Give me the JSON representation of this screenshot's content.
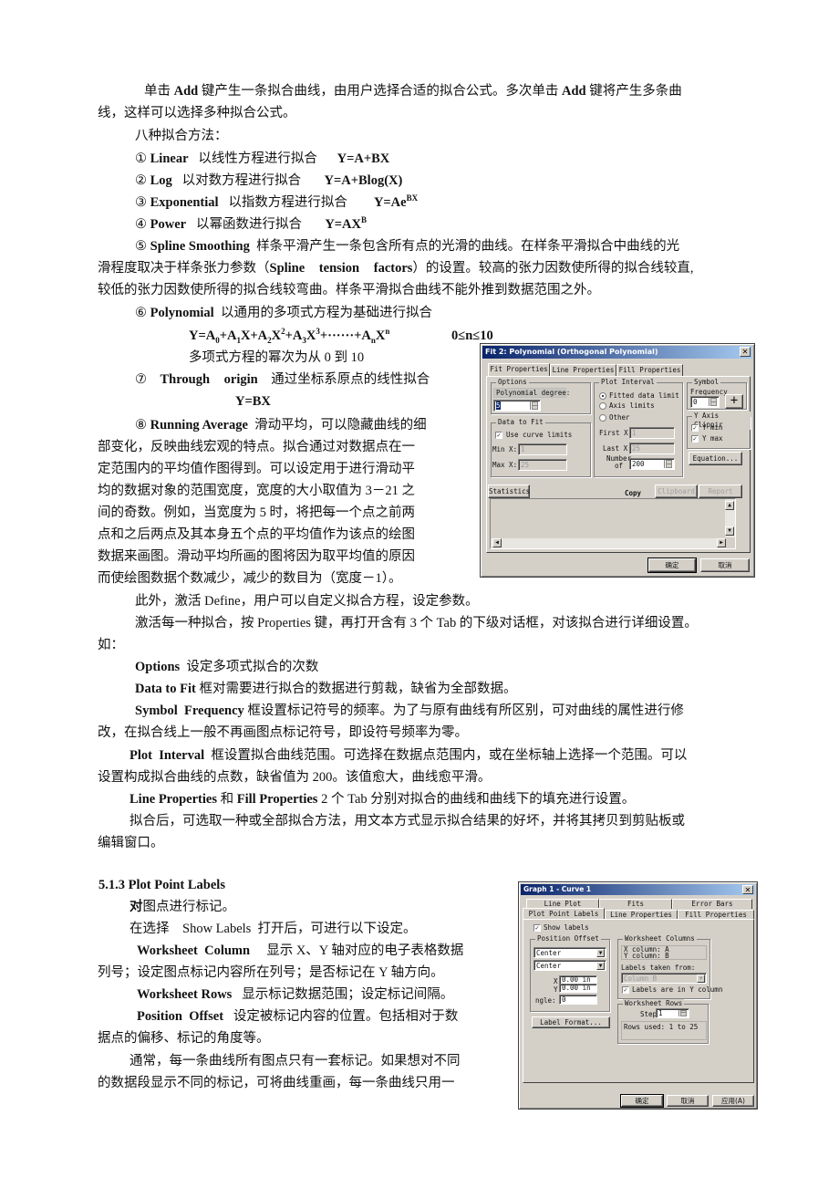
{
  "document": {
    "para1": {
      "pre": "单击 ",
      "b1": "Add",
      "mid": " 键产生一条拟合曲线，由用户选择合适的拟合公式。多次单击 ",
      "b2": "Add",
      "post": " 键将产生多条曲",
      "line2": "线，这样可以选择多种拟合公式。"
    },
    "methods_heading": "八种拟合方法：",
    "methods": [
      {
        "num": "①",
        "name": "Linear",
        "desc": "以线性方程进行拟合",
        "formula": "Y=A+BX"
      },
      {
        "num": "②",
        "name": "Log",
        "desc": "以对数方程进行拟合",
        "formula": "Y=A+Blog(X)"
      },
      {
        "num": "③",
        "name": "Exponential",
        "desc": "以指数方程进行拟合",
        "formula_base": "Y=Ae",
        "formula_sup": "BX"
      },
      {
        "num": "④",
        "name": "Power",
        "desc": "以幂函数进行拟合",
        "formula_base": "Y=AX",
        "formula_sup": "B"
      }
    ],
    "spline": {
      "num": "⑤",
      "name": "Spline Smoothing",
      "line1": "样条平滑产生一条包含所有点的光滑的曲线。在样条平滑拟合中曲线的光",
      "line2_pre": "滑程度取决于样条张力参数（",
      "line2_b": "Spline tension factors",
      "line2_post": "）的设置。较高的张力因数使所得的拟合线较直,",
      "line3": "较低的张力因数使所得的拟合线较弯曲。样条平滑拟合曲线不能外推到数据范围之外。"
    },
    "polynomial": {
      "num": "⑥",
      "name": "Polynomial",
      "desc": "以通用的多项式方程为基础进行拟合",
      "formula": "Y=A0+A1X+A2X2+A3X3+······+AnXn",
      "range": "0≤n≤10",
      "note": "多项式方程的幂次为从 0 到 10"
    },
    "through_origin": {
      "num": "⑦",
      "name": "Through origin",
      "desc": "通过坐标系原点的线性拟合",
      "formula": "Y=BX"
    },
    "running_avg": {
      "num": "⑧",
      "name": "Running Average",
      "desc": "滑动平均，可以隐藏曲线的细",
      "lines": [
        "部变化，反映曲线宏观的特点。拟合通过对数据点在一",
        "定范围内的平均值作图得到。可以设定用于进行滑动平",
        "均的数据对象的范围宽度，宽度的大小取值为 3－21 之",
        "间的奇数。例如，当宽度为 5 时，将把每一个点之前两",
        "点和之后两点及其本身五个点的平均值作为该点的绘图",
        "数据来画图。滑动平均所画的图将因为取平均值的原因",
        "而使绘图数据个数减少，减少的数目为（宽度－1）。"
      ]
    },
    "define_line": "此外，激活 Define，用户可以自定义拟合方程，设定参数。",
    "properties_line": "激活每一种拟合，按 Properties 键，再打开含有 3 个 Tab 的下级对话框，对该拟合进行详细设置。",
    "properties_line2": "如：",
    "options": {
      "b": "Options",
      "text": "设定多项式拟合的次数"
    },
    "data_to_fit": {
      "b": "Data to Fit",
      "text": "框对需要进行拟合的数据进行剪裁，缺省为全部数据。"
    },
    "symbol_freq": {
      "b": "Symbol  Frequency",
      "text": "框设置标记符号的频率。为了与原有曲线有所区别，可对曲线的属性进行修",
      "line2": "改，在拟合线上一般不再画图点标记符号，即设符号频率为零。"
    },
    "plot_interval": {
      "b": "Plot  Interval",
      "text": "框设置拟合曲线范围。可选择在数据点范围内，或在坐标轴上选择一个范围。可以",
      "line2": "设置构成拟合曲线的点数，缺省值为 200。该值愈大，曲线愈平滑。"
    },
    "line_fill": {
      "b1": "Line Properties",
      "mid": " 和 ",
      "b2": "Fill Properties",
      "post": " 2 个 Tab 分别对拟合的曲线和曲线下的填充进行设置。"
    },
    "after_fit": {
      "line1": "拟合后，可选取一种或全部拟合方法，用文本方式显示拟合结果的好坏，并将其拷贝到剪贴板或",
      "line2": "编辑窗口。"
    },
    "section_513": {
      "heading": "5.1.3 Plot Point Labels",
      "intro_b": "对",
      "intro": "图点进行标记。",
      "show_labels": "在选择    Show Labels  打开后，可进行以下设定。",
      "ws_col_b": "Worksheet  Column",
      "ws_col": "显示 X、Y 轴对应的电子表格数据",
      "ws_col2": "列号；设定图点标记内容所在列号；是否标记在 Y 轴方向。",
      "ws_rows_b": "Worksheet Rows",
      "ws_rows": "显示标记数据范围；设定标记间隔。",
      "pos_b": "Position  Offset",
      "pos": "设定被标记内容的位置。包括相对于数",
      "pos2": "据点的偏移、标记的角度等。",
      "normal1": "通常，每一条曲线所有图点只有一套标记。如果想对不同",
      "normal2": "的数据段显示不同的标记，可将曲线重画，每一条曲线只用一"
    }
  },
  "fit_dialog": {
    "title": "Fit 2: Polynomial (Orthogonal Polynomial)",
    "close": "✕",
    "tabs": [
      "Fit Properties",
      "Line Properties",
      "Fill Properties"
    ],
    "active_tab": 0,
    "options": {
      "group": "Options",
      "label": "Polynomial degree:",
      "value": "5"
    },
    "data_to_fit": {
      "group": "Data to Fit",
      "use_curve_limits": "Use curve limits",
      "use_curve_limits_checked": true,
      "min_x_label": "Min X:",
      "min_x": "1",
      "max_x_label": "Max X:",
      "max_x": "25"
    },
    "plot_interval": {
      "group": "Plot Interval",
      "radios": [
        "Fitted data limit",
        "Axis limits",
        "Other"
      ],
      "selected": 0,
      "first_x_label": "First X:",
      "first_x": "1",
      "last_x_label": "Last X:",
      "last_x": "25",
      "number_label1": "Number",
      "number_label2": "of",
      "number": "200"
    },
    "symbol": {
      "group": "Symbol",
      "freq_label": "Frequency",
      "freq": "0",
      "symbol_glyph": "+"
    },
    "y_axis_clipping": {
      "group": "Y Axis Clippir",
      "y_min": "Y min",
      "y_min_checked": true,
      "y_max": "Y max",
      "y_max_checked": true
    },
    "equation_button": "Equation...",
    "statistics_button": "Statistics",
    "copy_label": "Copy",
    "clipboard_button": "Clipboard",
    "report_button": "Report",
    "ok_button": "确定",
    "cancel_button": "取消"
  },
  "curve_dialog": {
    "title": "Graph 1 - Curve 1",
    "close": "✕",
    "tabs_row1": [
      "Line Plot",
      "Fits",
      "Error Bars"
    ],
    "tabs_row2": [
      "Plot Point Labels",
      "Line Properties",
      "Fill Properties"
    ],
    "active_tab": "Plot Point Labels",
    "show_labels": "Show labels",
    "show_labels_checked": true,
    "position_offset": {
      "group": "Position Offset",
      "combo1": "Center",
      "combo2": "Center",
      "x_label": "X",
      "x": "0.00 in",
      "y_label": "Y",
      "y": "0.00 in",
      "angle_label": "ngle:",
      "angle": "0"
    },
    "label_format_button": "Label Format...",
    "worksheet_columns": {
      "group": "Worksheet Columns",
      "x_col": "X column: A",
      "y_col": "Y column: B",
      "labels_taken_from": "Labels taken from:",
      "column_value": "Column B",
      "labels_in_y": "Labels are in Y column",
      "labels_in_y_checked": true
    },
    "worksheet_rows": {
      "group": "Worksheet Rows",
      "step_label": "Step",
      "step": "1",
      "rows_used": "Rows used: 1 to 25"
    },
    "ok_button": "确定",
    "cancel_button": "取消",
    "apply_button": "应用(A)"
  }
}
